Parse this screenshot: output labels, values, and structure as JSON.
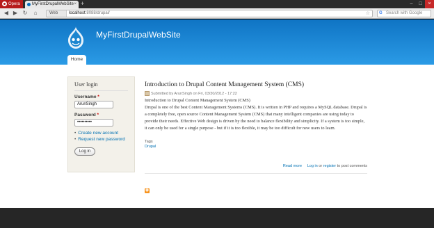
{
  "browser": {
    "menu_label": "Opera",
    "tab_title": "MyFirstDrupalWebSite",
    "new_tab": "+",
    "address_label": "Web",
    "address_host": "localhost",
    "address_path": ":8088/drupal/",
    "search_placeholder": "Search with Google"
  },
  "site": {
    "name": "MyFirstDrupalWebSite",
    "nav_home": "Home"
  },
  "login_block": {
    "title": "User login",
    "username_label": "Username",
    "username_value": "ArunSingh",
    "password_label": "Password",
    "password_value": "••••••••••",
    "required_mark": "*",
    "links": [
      "Create new account",
      "Request new password"
    ],
    "submit_label": "Log in"
  },
  "article": {
    "title": "Introduction to Drupal Content Management System (CMS)",
    "submitted": "Submitted by ArunSingh on Fri, 03/30/2012 - 17:22",
    "body_line1": "Introduction to Drupal Content Management System (CMS)",
    "body_paragraph": "Drupal is one of the best Content Management Systems (CMS). It is written in PHP and requires a MySQL database. Drupal is a completely free, open source Content Management System (CMS) that many intelligent companies are using today to provide their needs. Effective Web design is driven by the need to balance flexibility and simplicity. If a system is too simple, it can only be used for a single purpose - but if it is too flexible, it may be too difficult for new users to learn.",
    "tags_label": "Tags",
    "tag": "Drupal",
    "read_more": "Read more",
    "log_in": "Log in",
    "or": "or",
    "register": "register",
    "to_post": "to post comments"
  },
  "colors": {
    "header_blue": "#0f74c4",
    "link_blue": "#0071b3",
    "footer": "#262626"
  }
}
